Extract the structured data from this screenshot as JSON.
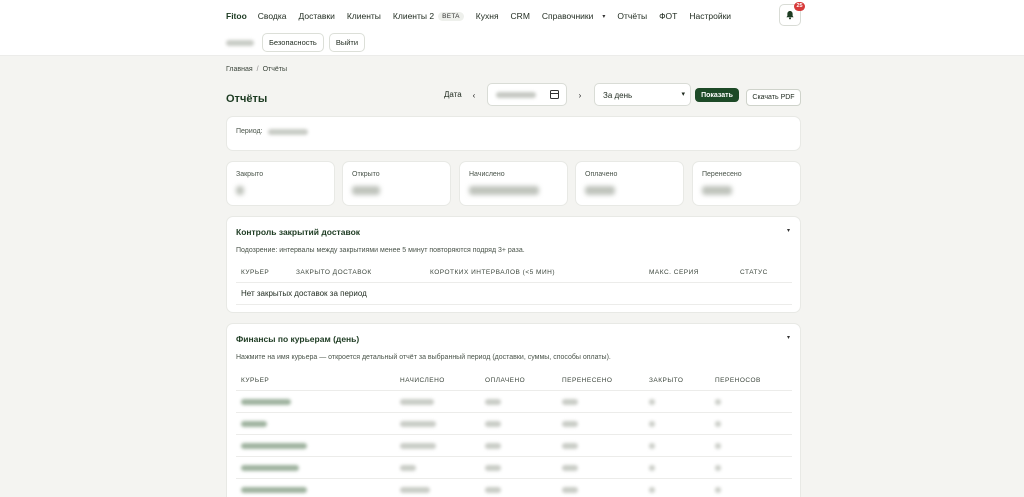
{
  "nav": {
    "brand": "Fitoo",
    "items": [
      "Сводка",
      "Доставки",
      "Клиенты",
      "Клиенты 2",
      "Кухня",
      "CRM",
      "Справочники",
      "Отчёты",
      "ФОТ",
      "Настройки"
    ],
    "beta_label": "BETA",
    "dropdown_caret": "▾",
    "notifications_count": "25"
  },
  "subnav": {
    "security": "Безопасность",
    "logout": "Выйти"
  },
  "breadcrumb": {
    "home": "Главная",
    "separator": "/",
    "current": "Отчёты"
  },
  "page": {
    "title": "Отчёты"
  },
  "filters": {
    "date_label": "Дата",
    "prev": "‹",
    "next": "›",
    "period_select": "За день",
    "show_button": "Показать",
    "pdf_button": "Скачать PDF"
  },
  "period": {
    "label": "Период:"
  },
  "stats": [
    "Закрыто",
    "Открыто",
    "Начислено",
    "Оплачено",
    "Перенесено"
  ],
  "control": {
    "title": "Контроль закрытий доставок",
    "toggle": "▾",
    "note": "Подозрение: интервалы между закрытиями менее 5 минут повторяются подряд 3+ раза.",
    "columns": [
      "КУРЬЕР",
      "ЗАКРЫТО ДОСТАВОК",
      "КОРОТКИХ ИНТЕРВАЛОВ (<5 МИН)",
      "МАКС. СЕРИЯ",
      "СТАТУС"
    ],
    "empty": "Нет закрытых доставок за период"
  },
  "finance": {
    "title": "Финансы по курьерам (день)",
    "toggle": "▾",
    "note": "Нажмите на имя курьера — откроется детальный отчёт за выбранный период (доставки, суммы, способы оплаты).",
    "columns": [
      "КУРЬЕР",
      "НАЧИСЛЕНО",
      "ОПЛАЧЕНО",
      "ПЕРЕНЕСЕНО",
      "ЗАКРЫТО",
      "ПЕРЕНОСОВ"
    ]
  },
  "colors": {
    "accent": "#1d4a27",
    "title": "#1d3b22",
    "badge": "#d73a3a",
    "background": "#f4f4f1"
  }
}
